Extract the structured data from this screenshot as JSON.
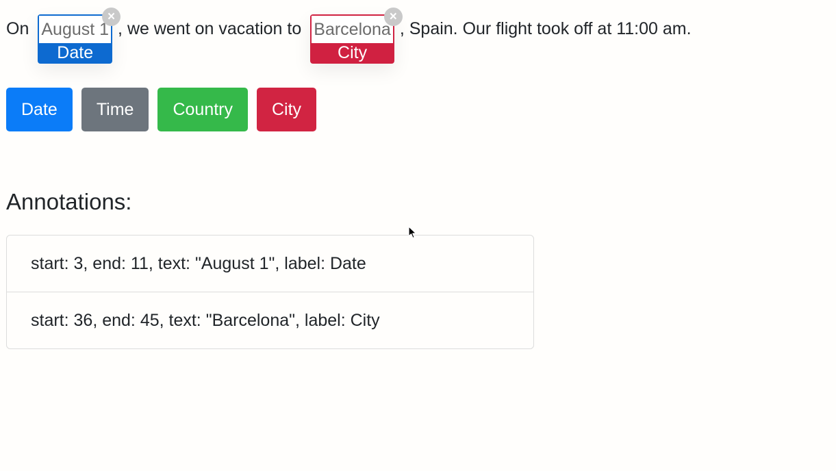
{
  "sentence": {
    "prefix": "On",
    "middle": ", we went on vacation to",
    "suffix": ", Spain. Our flight took off at 11:00 am.",
    "chips": [
      {
        "text": "August 1",
        "label": "Date",
        "close_icon": "×",
        "color": "#0d6ad0"
      },
      {
        "text": "Barcelona",
        "label": "City",
        "close_icon": "×",
        "color": "#d02141"
      }
    ]
  },
  "label_buttons": [
    {
      "label": "Date",
      "color": "#0b7cf8"
    },
    {
      "label": "Time",
      "color": "#6d757d"
    },
    {
      "label": "Country",
      "color": "#35b94a"
    },
    {
      "label": "City",
      "color": "#d12442"
    }
  ],
  "annotations": {
    "heading": "Annotations:",
    "items": [
      "start: 3, end: 11, text: \"August 1\", label: Date",
      "start: 36, end: 45, text: \"Barcelona\", label: City"
    ]
  },
  "icons": {
    "close": "close-icon",
    "cursor": "mouse-cursor-icon"
  }
}
